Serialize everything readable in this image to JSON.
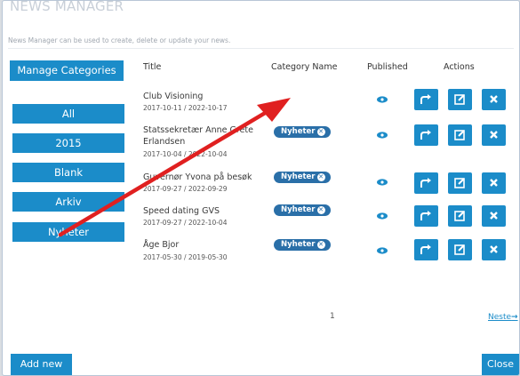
{
  "window": {
    "title": "NEWS MANAGER",
    "subtitle": "News Manager can be used to create, delete or update your news."
  },
  "sidebar": {
    "manage_label": "Manage Categories",
    "categories": [
      "All",
      "2015",
      "Blank",
      "Arkiv",
      "Nyheter"
    ]
  },
  "table": {
    "headers": {
      "title": "Title",
      "category": "Category Name",
      "published": "Published",
      "actions": "Actions"
    },
    "rows": [
      {
        "title": "Club Visioning",
        "dates": "2017-10-11 / 2022-10-17",
        "category": ""
      },
      {
        "title": "Statssekretær Anne Grete Erlandsen",
        "dates": "2017-10-04 / 2022-10-04",
        "category": "Nyheter"
      },
      {
        "title": "Guvernør Yvona på besøk",
        "dates": "2017-09-27 / 2022-09-29",
        "category": "Nyheter"
      },
      {
        "title": "Speed dating GVS",
        "dates": "2017-09-27 / 2022-10-04",
        "category": "Nyheter"
      },
      {
        "title": "Åge Bjor",
        "dates": "2017-05-30 / 2019-05-30",
        "category": "Nyheter"
      }
    ]
  },
  "pager": {
    "current": "1",
    "next_label": "Neste"
  },
  "footer": {
    "add_label": "Add new",
    "close_label": "Close"
  },
  "colors": {
    "accent": "#1b8cc9",
    "badge": "#2a6fa8",
    "arrow": "#e02020"
  }
}
